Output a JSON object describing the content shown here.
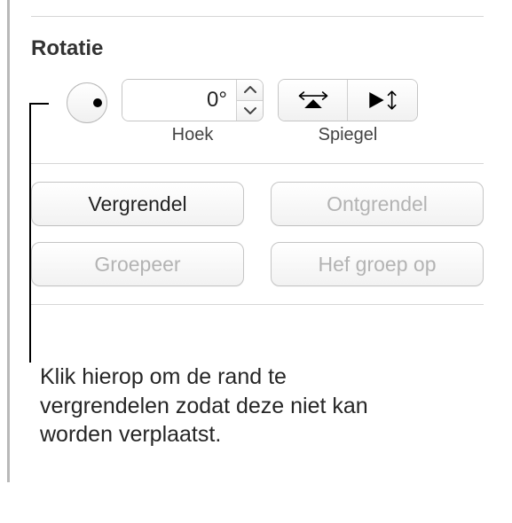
{
  "section": {
    "title": "Rotatie",
    "angle_value": "0°",
    "angle_label": "Hoek",
    "mirror_label": "Spiegel"
  },
  "buttons": {
    "lock": "Vergrendel",
    "unlock": "Ontgrendel",
    "group": "Groepeer",
    "ungroup": "Hef groep op"
  },
  "callout": {
    "text": "Klik hierop om de rand te vergrendelen zodat deze niet kan worden verplaatst."
  }
}
